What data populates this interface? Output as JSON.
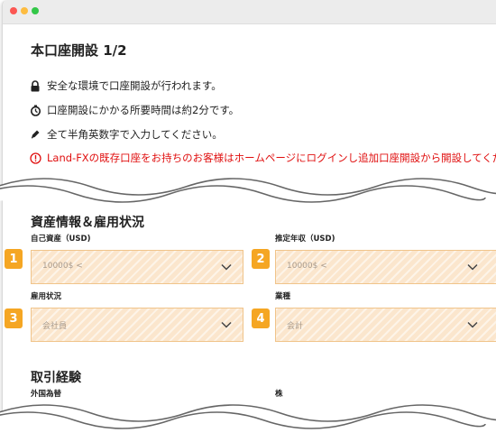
{
  "page": {
    "title": "本口座開設 1/2",
    "info": [
      {
        "icon": "lock-icon",
        "text": "安全な環境で口座開設が行われます。"
      },
      {
        "icon": "stopwatch-icon",
        "text": "口座開設にかかる所要時間は約2分です。"
      },
      {
        "icon": "pen-icon",
        "text": "全て半角英数字で入力してください。"
      }
    ],
    "notice": "Land-FXの既存口座をお持ちのお客様はホームページにログインし追加口座開設から開設してくださ"
  },
  "assets": {
    "title": "資産情報＆雇用状況",
    "fields": [
      {
        "badge": "1",
        "label": "自己資産（USD)",
        "value": "10000$ <"
      },
      {
        "badge": "2",
        "label": "推定年収（USD)",
        "value": "10000$ <"
      },
      {
        "badge": "3",
        "label": "雇用状況",
        "value": "会社員"
      },
      {
        "badge": "4",
        "label": "業種",
        "value": "会計"
      }
    ]
  },
  "trading": {
    "title": "取引経験",
    "labels": [
      "外国為替",
      "株"
    ]
  },
  "colors": {
    "accent": "#f5a623",
    "notice": "#e01010",
    "select_bg": "#fbe6cd",
    "select_border": "#f0c48a"
  }
}
